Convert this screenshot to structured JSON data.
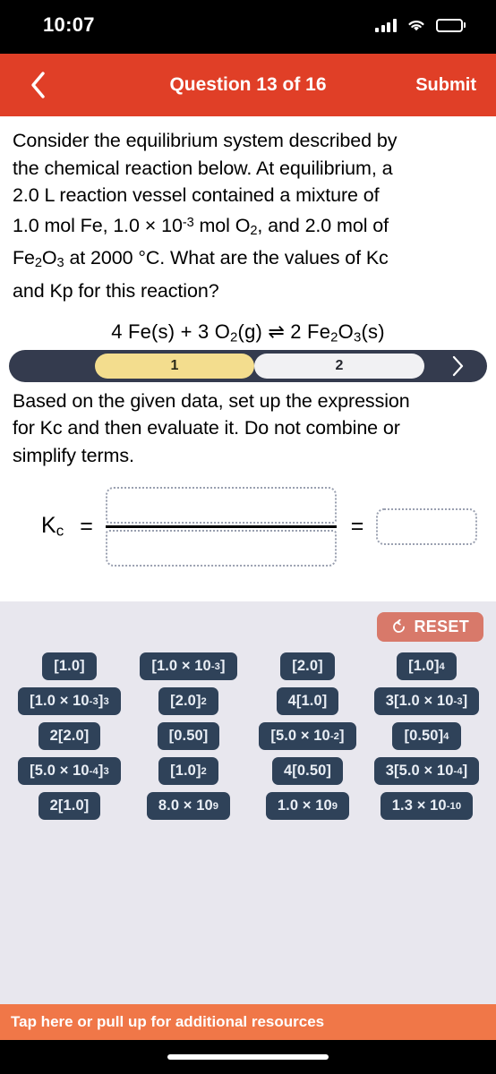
{
  "status_bar": {
    "time": "10:07",
    "signal_icon": "cellular-signal-icon",
    "wifi_icon": "wifi-icon",
    "battery_icon": "battery-icon"
  },
  "nav": {
    "back_icon": "chevron-left-icon",
    "title": "Question 13 of 16",
    "submit_label": "Submit",
    "accent_color": "#e03f27"
  },
  "question": {
    "prompt_line1": "Consider the equilibrium system described by",
    "prompt_line2": "the chemical reaction below. At equilibrium, a",
    "prompt_line3": "2.0 L reaction vessel contained a mixture of",
    "prompt_line4a": "1.0 mol Fe, 1.0 × 10",
    "prompt_line4b": "-3",
    "prompt_line4c": " mol O",
    "prompt_line4d": "2",
    "prompt_line4e": ", and 2.0 mol of",
    "prompt_line5a": "Fe",
    "prompt_line5b": "2",
    "prompt_line5c": "O",
    "prompt_line5d": "3",
    "prompt_line5e": " at 2000 °C. What are the values of Kc",
    "prompt_line6": "and Kp for this reaction?",
    "equation": {
      "reactant_coeff_1": "4 Fe(s) + 3 O",
      "reactant_sub_1": "2",
      "reactant_state_1": "(g) ",
      "arrow": "⇌",
      "product_coeff": " 2 Fe",
      "product_sub_1": "2",
      "product_mid": "O",
      "product_sub_2": "3",
      "product_state": "(s)"
    }
  },
  "steps": {
    "bar_color": "#343b4e",
    "active_color": "#f3dd8e",
    "items": [
      {
        "label": "1",
        "active": true
      },
      {
        "label": "2",
        "active": false
      }
    ],
    "next_icon": "chevron-right-icon"
  },
  "instruction": {
    "line1": "Based on the given data, set up the expression",
    "line2": "for Kc and then evaluate it. Do not combine or",
    "line3": "simplify terms."
  },
  "expression": {
    "kc_label": "K",
    "kc_subscript": "c",
    "equals_1": "=",
    "equals_2": "=",
    "numerator_value": "",
    "denominator_value": "",
    "result_value": ""
  },
  "tray": {
    "background_color": "#e8e7ee",
    "reset": {
      "label": "RESET",
      "icon": "reset-circular-arrow-icon",
      "color": "#d8796a"
    },
    "tile_color": "#2f4259",
    "tiles": [
      {
        "base": "[1.0]",
        "sup": ""
      },
      {
        "base": "[1.0 × 10",
        "exp": "-3",
        "tail": "]",
        "sup": ""
      },
      {
        "base": "[2.0]",
        "sup": ""
      },
      {
        "base": "[1.0]",
        "sup": "4"
      },
      {
        "base": "[1.0 × 10",
        "exp": "-3",
        "tail": "]",
        "sup": "3"
      },
      {
        "base": "[2.0]",
        "sup": "2"
      },
      {
        "base": "4[1.0]",
        "sup": ""
      },
      {
        "base": "3[1.0 × 10",
        "exp": "-3",
        "tail": "]",
        "sup": ""
      },
      {
        "base": "2[2.0]",
        "sup": ""
      },
      {
        "base": "[0.50]",
        "sup": ""
      },
      {
        "base": "[5.0 × 10",
        "exp": "-2",
        "tail": "]",
        "sup": ""
      },
      {
        "base": "[0.50]",
        "sup": "4"
      },
      {
        "base": "[5.0 × 10",
        "exp": "-4",
        "tail": "]",
        "sup": "3"
      },
      {
        "base": "[1.0]",
        "sup": "2"
      },
      {
        "base": "4[0.50]",
        "sup": ""
      },
      {
        "base": "3[5.0 × 10",
        "exp": "-4",
        "tail": "]",
        "sup": ""
      },
      {
        "base": "2[1.0]",
        "sup": ""
      },
      {
        "base": "8.0 × 10",
        "exp": "",
        "tail": "",
        "sup": "9"
      },
      {
        "base": "1.0 × 10",
        "exp": "",
        "tail": "",
        "sup": "9"
      },
      {
        "base": "1.3 × 10",
        "exp": "",
        "tail": "",
        "sup": "-10"
      }
    ]
  },
  "resource_bar": {
    "label": "Tap here or pull up for additional resources",
    "color": "#f07748"
  }
}
